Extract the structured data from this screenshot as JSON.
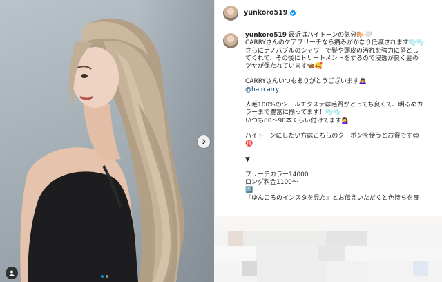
{
  "post": {
    "username": "yunkoro519",
    "verified": true
  },
  "caption": {
    "username": "yunkoro519",
    "lines": [
      " 最近はハイトーンの気分🐎🤍",
      "CARRYさんのケアブリーチなら痛みがかなり低減されます🫧🫧",
      "さらにナノバブルのシャワーで髪や頭皮の汚れを強力に落とし",
      "てくれて、その後にトリートメントをするので浸透が良く髪の",
      "ツヤが保たれています🦋🥰",
      "",
      "CARRYさんいつもありがとうございます🙇‍♀️",
      "@haircarry",
      "",
      "人毛100%のシールエクステは毛質がとっても良くて、明るめカ",
      "ラーまで豊富に揃ってます！🫧🫧",
      "いつも80〜90本くらい付けてます💁‍♀️",
      "",
      "ハイトーンにしたい方はこちらのクーポンを使うとお得です😊",
      "🉐",
      "",
      "▼",
      "",
      "ブリーチカラー14000",
      "ロング料金1100〜",
      "1️⃣",
      "『ゆんころのインスタを見た』とお伝えいただくと色持ちを良"
    ]
  },
  "icons": {
    "next": "chevron-right-icon",
    "tag": "user-tag-icon",
    "verified": "verified-badge-icon"
  },
  "colors": {
    "verified": "#0095f6",
    "link": "#00376b",
    "dot_active": "#0095f6"
  },
  "carousel": {
    "slides": 2,
    "active": 1
  }
}
